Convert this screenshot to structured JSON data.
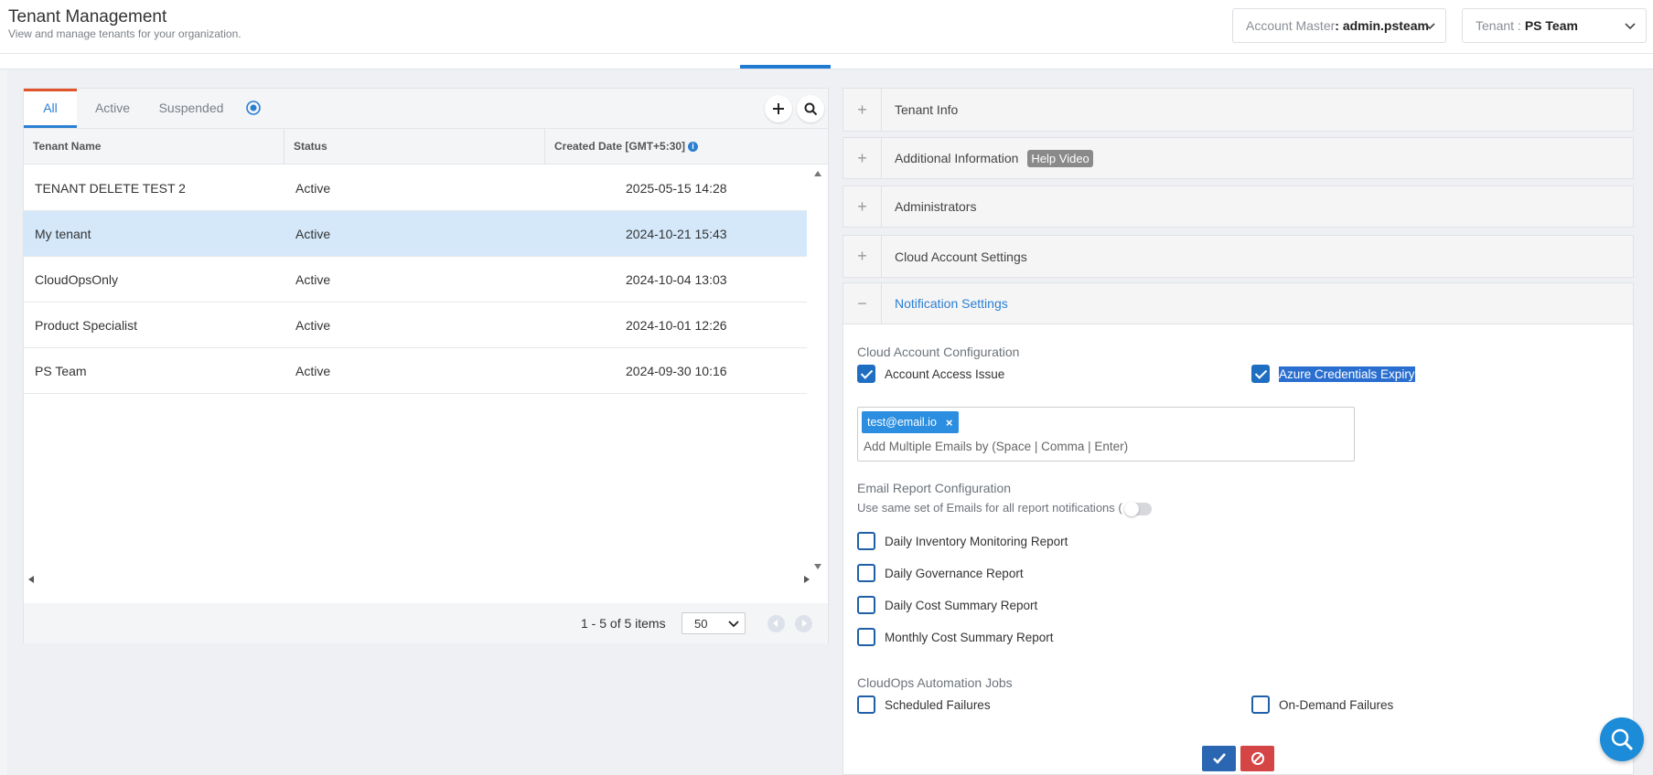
{
  "header": {
    "title": "Tenant Management",
    "subtitle": "View and manage tenants for your organization.",
    "account_label": "Account Master",
    "account_value": ": admin.psteam",
    "tenant_label": "Tenant : ",
    "tenant_value": "PS Team"
  },
  "tabs": {
    "all": "All",
    "active": "Active",
    "suspended": "Suspended"
  },
  "table": {
    "columns": [
      "Tenant Name",
      "Status",
      "Created Date [GMT+5:30]"
    ],
    "rows": [
      {
        "name": "TENANT DELETE TEST 2",
        "status": "Active",
        "date": "2025-05-15 14:28",
        "selected": false
      },
      {
        "name": "My tenant",
        "status": "Active",
        "date": "2024-10-21 15:43",
        "selected": true
      },
      {
        "name": "CloudOpsOnly",
        "status": "Active",
        "date": "2024-10-04 13:03",
        "selected": false
      },
      {
        "name": "Product Specialist",
        "status": "Active",
        "date": "2024-10-01 12:26",
        "selected": false
      },
      {
        "name": "PS Team",
        "status": "Active",
        "date": "2024-09-30 10:16",
        "selected": false
      }
    ]
  },
  "pager": {
    "summary": "1 - 5 of 5 items",
    "page_size": "50"
  },
  "accordion": {
    "tenant_info": "Tenant Info",
    "additional_info": "Additional Information",
    "help_video": "Help Video",
    "administrators": "Administrators",
    "cloud_account_settings": "Cloud Account Settings",
    "notification_settings": "Notification Settings"
  },
  "notifications": {
    "cloud_account_config": "Cloud Account Configuration",
    "account_access_issue": "Account Access Issue",
    "azure_credentials_expiry": "Azure Credentials Expiry",
    "email_chip": "test@email.io",
    "email_placeholder": "Add Multiple Emails by (Space | Comma | Enter)",
    "email_report_config": "Email Report Configuration",
    "same_emails_label": "Use same set of Emails for all report notifications (",
    "daily_inventory": "Daily Inventory Monitoring Report",
    "daily_governance": "Daily Governance Report",
    "daily_cost": "Daily Cost Summary Report",
    "monthly_cost": "Monthly Cost Summary Report",
    "cloudops_jobs": "CloudOps Automation Jobs",
    "scheduled_failures": "Scheduled Failures",
    "on_demand_failures": "On-Demand Failures"
  },
  "colors": {
    "accent": "#2b7fd1",
    "selected_row": "#d4e8fa",
    "save": "#2a66b2",
    "cancel": "#d64545"
  }
}
